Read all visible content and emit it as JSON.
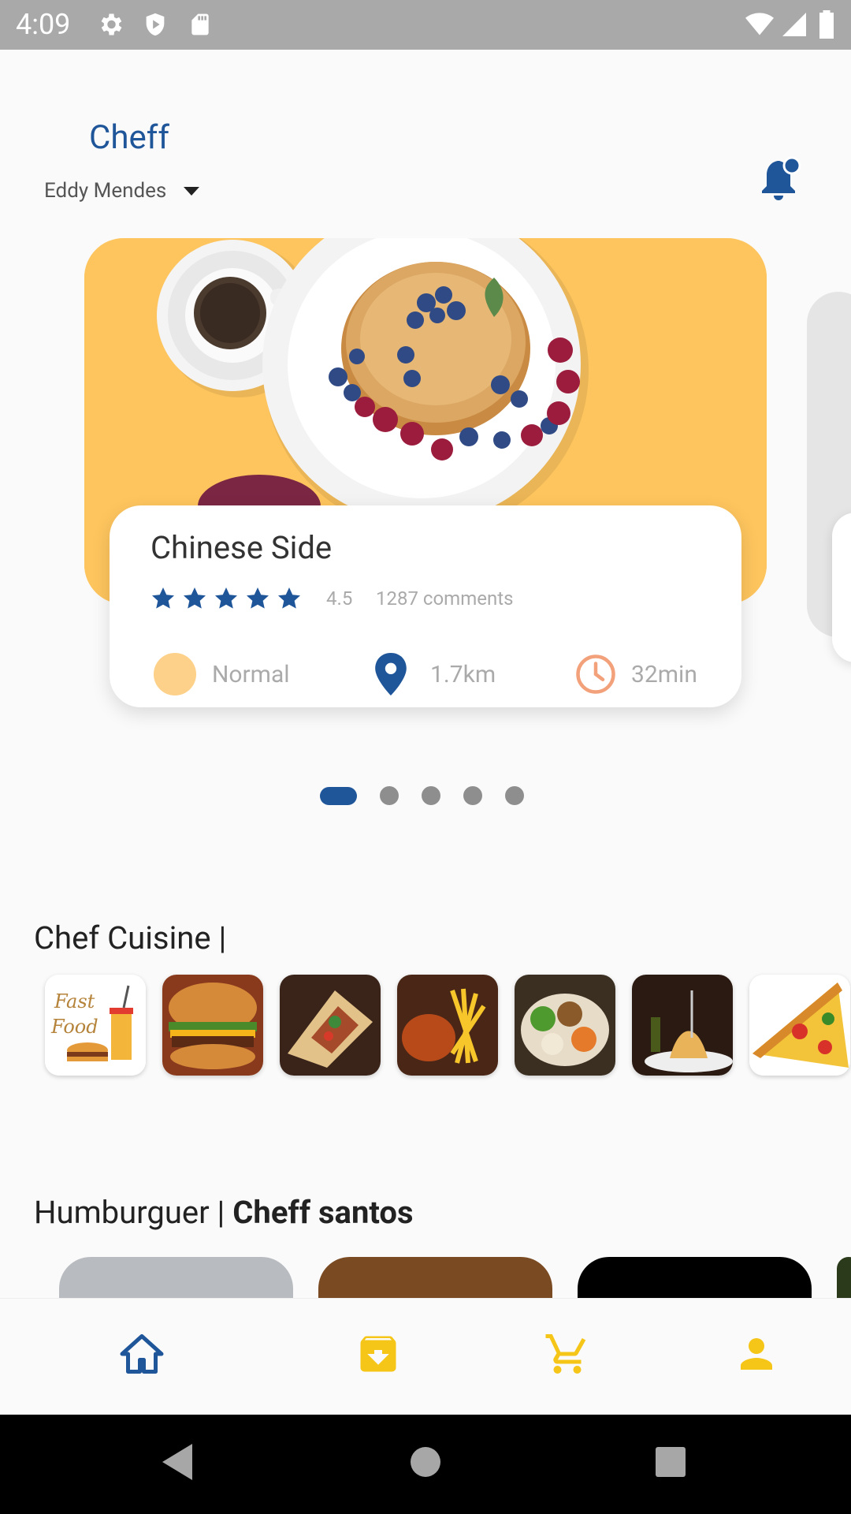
{
  "status_bar": {
    "time": "4:09"
  },
  "header": {
    "app_title": "Cheff",
    "user_name": "Eddy Mendes"
  },
  "featured": {
    "dish_name": "Chinese Side",
    "stars": 5,
    "rating": "4.5",
    "comments": "1287 comments",
    "level": "Normal",
    "distance": "1.7km",
    "time": "32min",
    "carousel_index": 1,
    "carousel_count": 5
  },
  "cuisine_section": {
    "title": "Chef Cuisine |",
    "items": [
      "fast-food",
      "burger",
      "wrap",
      "chicken-fries",
      "salad-bowl",
      "spaghetti",
      "pizza"
    ]
  },
  "burger_section": {
    "title_prefix": "Humburguer | ",
    "title_bold": "Cheff santos"
  },
  "bottom_nav": {
    "items": [
      "home-icon",
      "archive-icon",
      "cart-icon",
      "profile-icon"
    ],
    "active": "home-icon"
  },
  "colors": {
    "primary": "#1f5599",
    "accent": "#f5c518",
    "card_bg": "#fec55e",
    "clock": "#f2a17a"
  }
}
